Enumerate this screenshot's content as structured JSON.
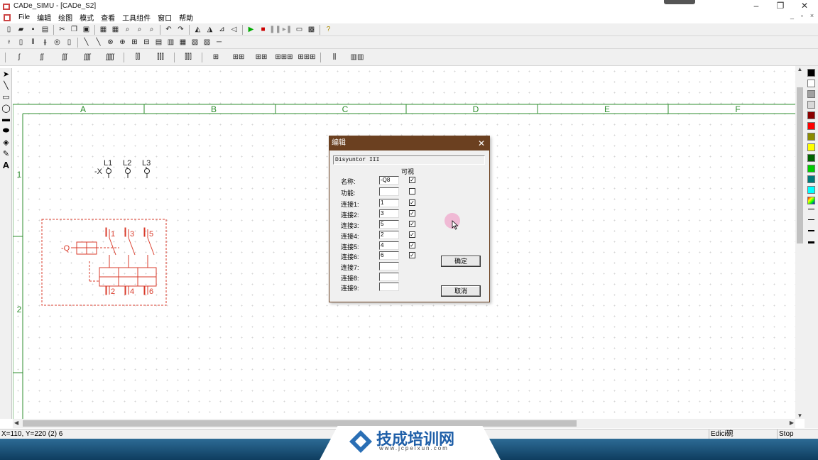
{
  "window": {
    "title": "CADe_SIMU - [CADe_S2]",
    "minimize": "–",
    "restore": "❐",
    "close": "✕"
  },
  "menu": [
    "File",
    "编辑",
    "绘图",
    "模式",
    "查看",
    "工具组件",
    "窗口",
    "帮助"
  ],
  "mdi_controls": [
    "_",
    "▫",
    "×"
  ],
  "columns": [
    "A",
    "B",
    "C",
    "D",
    "E",
    "F"
  ],
  "rows": [
    "1",
    "2"
  ],
  "drawing": {
    "supply_ref": "-X",
    "supply_terms": [
      "L1",
      "L2",
      "L3"
    ],
    "breaker_ref": "-Q",
    "breaker_top": [
      "1",
      "3",
      "5"
    ],
    "breaker_bottom": [
      "2",
      "4",
      "6"
    ]
  },
  "dialog": {
    "title": "编辑",
    "description": "Disyuntor III",
    "visible_header": "可视",
    "rows": [
      {
        "label": "名称:",
        "value": "-Q8",
        "checked": true
      },
      {
        "label": "功能:",
        "value": "",
        "checked": false
      },
      {
        "label": "连接1:",
        "value": "1",
        "checked": true
      },
      {
        "label": "连接2:",
        "value": "3",
        "checked": true
      },
      {
        "label": "连接3:",
        "value": "5",
        "checked": true
      },
      {
        "label": "连接4:",
        "value": "2",
        "checked": true
      },
      {
        "label": "连接5:",
        "value": "4",
        "checked": true
      },
      {
        "label": "连接6:",
        "value": "6",
        "checked": true
      },
      {
        "label": "连接7:",
        "value": "",
        "checked": null
      },
      {
        "label": "连接8:",
        "value": "",
        "checked": null
      },
      {
        "label": "连接9:",
        "value": "",
        "checked": null
      }
    ],
    "ok": "确定",
    "cancel": "取消"
  },
  "status": {
    "coords": "X=110, Y=220 (2) 6",
    "mode": "Edici碗",
    "state": "Stop"
  },
  "watermark": {
    "name": "技成培训网",
    "url": "www.jcpeixun.com"
  },
  "colors": {
    "accent": "#6b4020",
    "drawing": "#d93b2b",
    "grid": "#2c8c2c",
    "palette": [
      "#000000",
      "#ffffff",
      "#a0a0a0",
      "#d8d8d8",
      "#8b0000",
      "#ff0000",
      "#8b8b00",
      "#ffff00",
      "#006400",
      "#00cc00",
      "#007b7b",
      "#00ffff"
    ]
  }
}
